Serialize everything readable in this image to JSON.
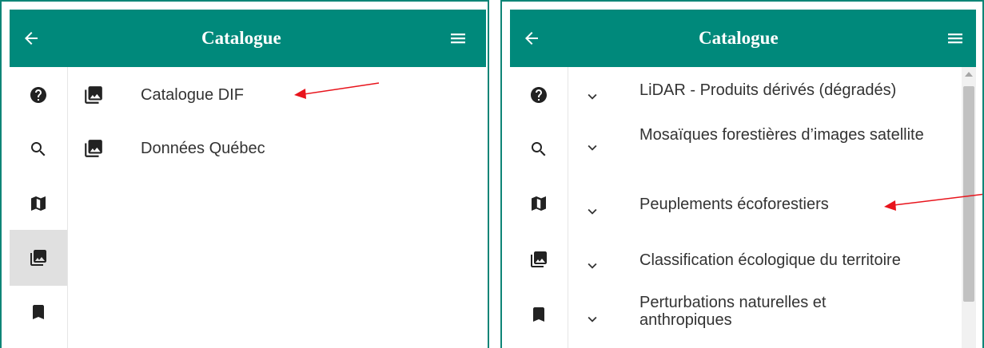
{
  "left_panel": {
    "title": "Catalogue",
    "items": [
      {
        "label": "Catalogue DIF",
        "icon": "photo-library-icon"
      },
      {
        "label": "Données Québec",
        "icon": "photo-library-icon"
      }
    ]
  },
  "right_panel": {
    "title": "Catalogue",
    "items": [
      {
        "label": "LiDAR - Produits dérivés (dégradés)"
      },
      {
        "label": "Mosaïques forestières d’images satellite"
      },
      {
        "label": "Peuplements écoforestiers"
      },
      {
        "label": "Classification écologique du territoire"
      },
      {
        "label": "Perturbations naturelles et anthropiques"
      }
    ]
  },
  "sidebar": {
    "items": [
      "help-icon",
      "search-icon",
      "map-icon",
      "photo-library-icon",
      "bookmark-icon"
    ],
    "active": "photo-library-icon"
  },
  "colors": {
    "header": "#00897b",
    "panel_border": "#0e8577",
    "annotation_arrow": "#e8141c",
    "active_sidebar": "#e0e0e0"
  }
}
